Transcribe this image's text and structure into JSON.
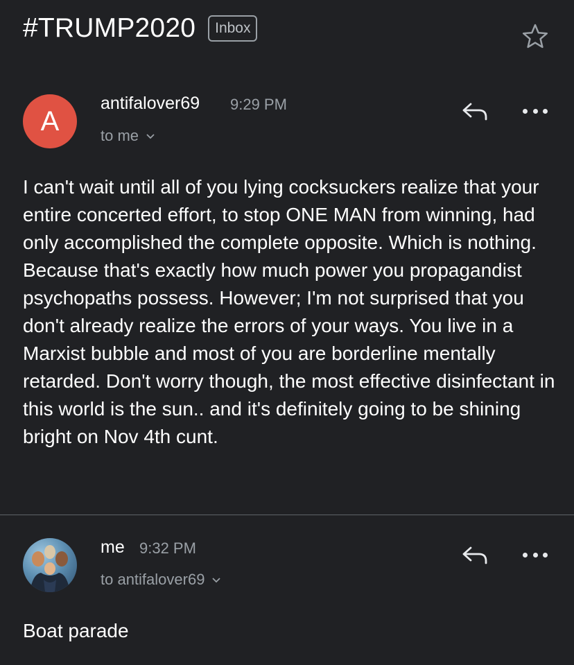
{
  "subject": "#TRUMP2020",
  "label": "Inbox",
  "icons": {
    "star": "star-outline-icon",
    "reply": "reply-icon",
    "more": "more-horizontal-icon",
    "expand": "chevron-down-icon"
  },
  "colors": {
    "background": "#202124",
    "avatar_letter_bg": "#e05243",
    "secondary_text": "#9aa0a6"
  },
  "messages": [
    {
      "avatar_letter": "A",
      "sender": "antifalover69",
      "time": "9:29 PM",
      "recipient": "to me",
      "body": "I can't wait until all of you lying cocksuckers realize that your entire concerted effort, to stop ONE MAN from winning, had only accomplished the complete opposite. Which is nothing. Because that's exactly how much power you propagandist psychopaths possess. However; I'm not surprised that you don't already realize the errors of your ways. You live in a Marxist bubble and most of you are borderline mentally retarded. Don't worry though, the most effective disinfectant in this world is the sun.. and it's definitely going to be shining bright on Nov 4th cunt."
    },
    {
      "sender": "me",
      "time": "9:32 PM",
      "recipient": "to antifalover69",
      "body": "Boat parade"
    }
  ]
}
